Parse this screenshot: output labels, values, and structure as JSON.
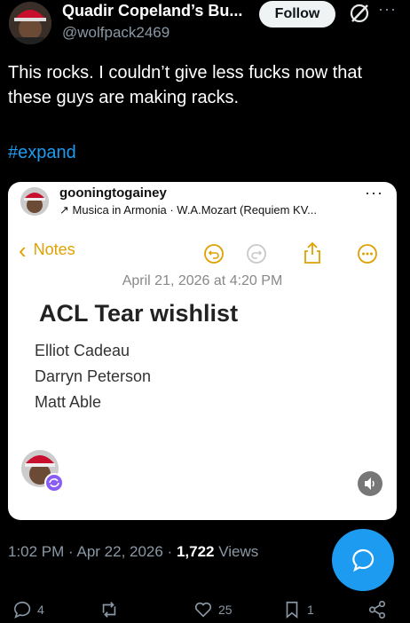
{
  "tweet": {
    "display_name": "Quadir Copeland’s Bu...",
    "handle": "@wolfpack2469",
    "follow_label": "Follow",
    "text": "This rocks. I couldn’t give less fucks now that these guys are making racks.",
    "hashtag": "#expand",
    "time": "1:02 PM · Apr 22, 2026 · ",
    "views_count": "1,722",
    "views_label": " Views"
  },
  "embed": {
    "username": "gooningtogainey",
    "music": "↗ Musica in Armonia · W.A.Mozart (Requiem KV...",
    "notes_back_label": "Notes",
    "note_date": "April 21, 2026 at 4:20 PM",
    "note_title": "ACL Tear wishlist",
    "note_lines": [
      "Elliot Cadeau",
      "Darryn Peterson",
      "Matt Able"
    ]
  },
  "actions": {
    "replies": "4",
    "reposts": "",
    "likes": "25",
    "bookmarks": "1"
  },
  "colors": {
    "accent": "#1d9bf0",
    "notes_yellow": "#e0a100",
    "purple_badge": "#8a5cf6"
  }
}
